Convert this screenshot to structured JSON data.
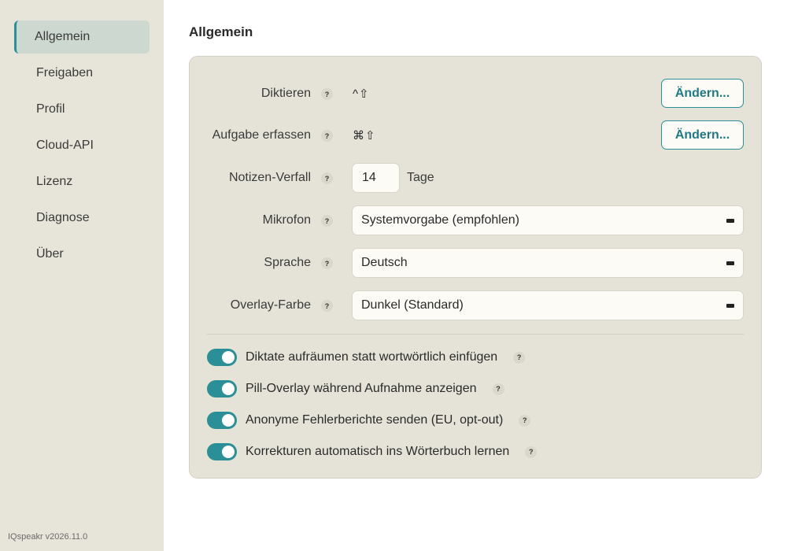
{
  "sidebar": {
    "items": [
      {
        "label": "Allgemein",
        "active": true
      },
      {
        "label": "Freigaben"
      },
      {
        "label": "Profil"
      },
      {
        "label": "Cloud-API"
      },
      {
        "label": "Lizenz"
      },
      {
        "label": "Diagnose"
      },
      {
        "label": "Über"
      }
    ],
    "version": "IQspeakr v2026.11.0"
  },
  "main": {
    "title": "Allgemein"
  },
  "settings": {
    "help_glyph": "?",
    "dictate": {
      "label": "Diktieren",
      "shortcut": "^⇧",
      "button": "Ändern..."
    },
    "capture": {
      "label": "Aufgabe erfassen",
      "shortcut": "⌘⇧",
      "button": "Ändern..."
    },
    "notes_expiry": {
      "label": "Notizen-Verfall",
      "value": "14",
      "unit": "Tage"
    },
    "microphone": {
      "label": "Mikrofon",
      "value": "Systemvorgabe (empfohlen)"
    },
    "language": {
      "label": "Sprache",
      "value": "Deutsch"
    },
    "overlay_color": {
      "label": "Overlay-Farbe",
      "value": "Dunkel (Standard)"
    }
  },
  "toggles": [
    {
      "label": "Diktate aufräumen statt wortwörtlich einfügen",
      "on": true
    },
    {
      "label": "Pill-Overlay während Aufnahme anzeigen",
      "on": true
    },
    {
      "label": "Anonyme Fehlerberichte senden (EU, opt-out)",
      "on": true
    },
    {
      "label": "Korrekturen automatisch ins Wörterbuch lernen",
      "on": true
    }
  ],
  "colors": {
    "accent": "#2a8f97",
    "sidebar_bg": "#e7e4d9",
    "card_bg": "#e5e3d8",
    "active_nav_bg": "#cdd8d1"
  }
}
